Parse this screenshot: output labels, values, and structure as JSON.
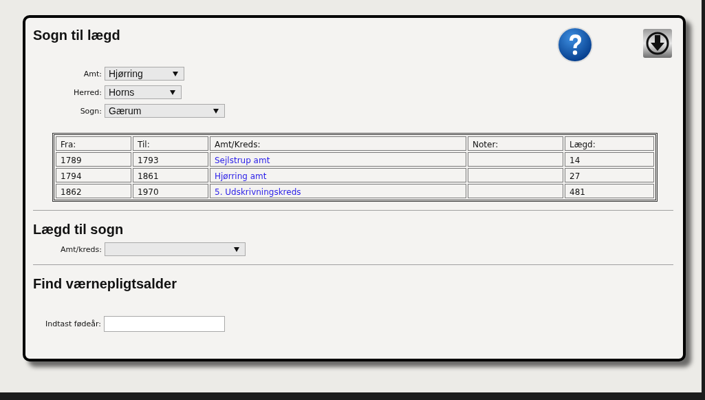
{
  "sections": [
    {
      "title": "Sogn til lægd",
      "fields": [
        {
          "kind": "select",
          "label": "Amt:",
          "value": "Hjørring"
        },
        {
          "kind": "select",
          "label": "Herred:",
          "value": "Horns"
        },
        {
          "kind": "select",
          "label": "Sogn:",
          "value": "Gærum"
        }
      ],
      "table": {
        "columns": [
          "Fra:",
          "Til:",
          "Amt/Kreds:",
          "Noter:",
          "Lægd:"
        ],
        "rows": [
          {
            "fra": "1789",
            "til": "1793",
            "amt_kreds": "Sejlstrup amt",
            "laegd": "14"
          },
          {
            "fra": "1794",
            "til": "1861",
            "amt_kreds": "Hjørring amt",
            "laegd": "27"
          },
          {
            "fra": "1862",
            "til": "1970",
            "amt_kreds": "5. Udskrivningskreds",
            "laegd": "481"
          }
        ]
      }
    },
    {
      "title": "Lægd til sogn",
      "fields": [
        {
          "kind": "select",
          "label": "Amt/kreds:"
        }
      ]
    },
    {
      "title": "Find værnepligtsalder",
      "fields": [
        {
          "kind": "input",
          "label": "Indtast fødeår:"
        }
      ]
    }
  ]
}
